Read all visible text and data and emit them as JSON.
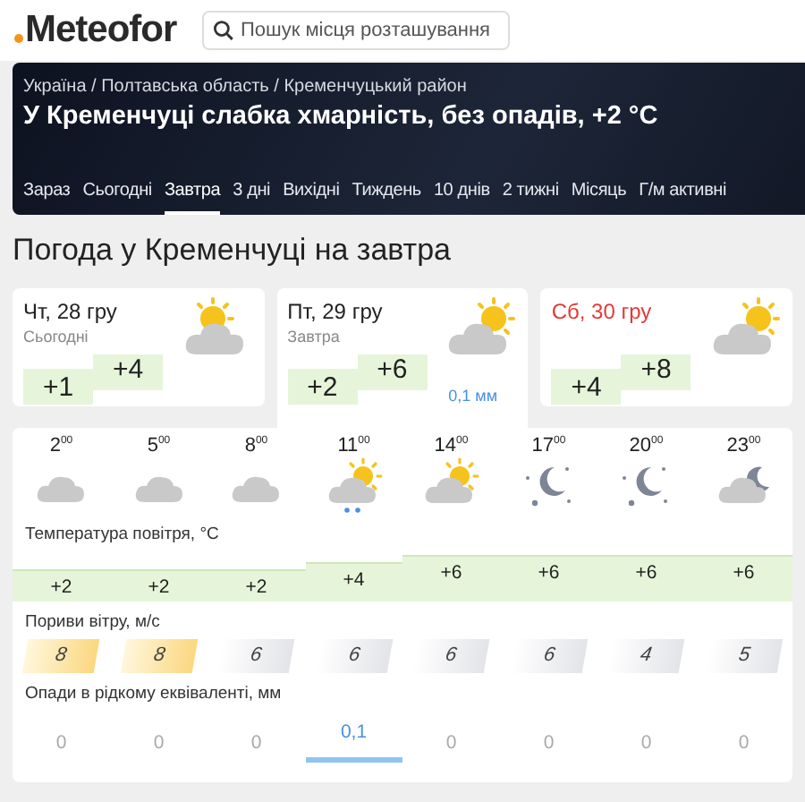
{
  "logo": "Meteofor",
  "search": {
    "placeholder": "Пошук місця розташування"
  },
  "banner": {
    "breadcrumb": "Україна / Полтавська область / Кременчуцький район",
    "headline": "У Кременчуці слабка хмарність, без опадів, +2 °C"
  },
  "tabs": [
    {
      "label": "Зараз",
      "selected": false
    },
    {
      "label": "Сьогодні",
      "selected": false
    },
    {
      "label": "Завтра",
      "selected": true
    },
    {
      "label": "3 дні",
      "selected": false
    },
    {
      "label": "Вихідні",
      "selected": false
    },
    {
      "label": "Тиждень",
      "selected": false
    },
    {
      "label": "10 днів",
      "selected": false
    },
    {
      "label": "2 тижні",
      "selected": false
    },
    {
      "label": "Місяць",
      "selected": false
    },
    {
      "label": "Г/м активні",
      "selected": false
    }
  ],
  "title": "Погода у Кременчуці на завтра",
  "days": [
    {
      "date": "Чт, 28 гру",
      "note": "Сьогодні",
      "min": "+1",
      "max": "+4",
      "kind": "sun-cloud",
      "weekend": false,
      "selected": false
    },
    {
      "date": "Пт, 29 гру",
      "note": "Завтра",
      "min": "+2",
      "max": "+6",
      "kind": "cloud-sun",
      "precip": "0,1 мм",
      "weekend": false,
      "selected": true
    },
    {
      "date": "Сб, 30 гру",
      "min": "+4",
      "max": "+8",
      "kind": "cloud-sun",
      "weekend": true,
      "selected": false
    }
  ],
  "hours": [
    {
      "hour": "2",
      "minutes": "00",
      "kind": "cloud",
      "temp": {
        "text": "+2",
        "kind": "low"
      },
      "gust": "8",
      "strong": true,
      "precip": "0",
      "rain": false
    },
    {
      "hour": "5",
      "minutes": "00",
      "kind": "cloud",
      "temp": {
        "text": "+2",
        "kind": "low"
      },
      "gust": "8",
      "strong": true,
      "precip": "0",
      "rain": false
    },
    {
      "hour": "8",
      "minutes": "00",
      "kind": "cloud",
      "temp": {
        "text": "+2",
        "kind": "low"
      },
      "gust": "6",
      "strong": false,
      "precip": "0",
      "rain": false
    },
    {
      "hour": "11",
      "minutes": "00",
      "kind": "cloud-sun-rain",
      "temp": {
        "text": "+4",
        "kind": "mid"
      },
      "gust": "6",
      "strong": false,
      "precip": "0,1",
      "rain": true
    },
    {
      "hour": "14",
      "minutes": "00",
      "kind": "cloud-sun",
      "temp": {
        "text": "+6",
        "kind": "high"
      },
      "gust": "6",
      "strong": false,
      "precip": "0",
      "rain": false
    },
    {
      "hour": "17",
      "minutes": "00",
      "kind": "moon-stars",
      "temp": {
        "text": "+6",
        "kind": "high"
      },
      "gust": "6",
      "strong": false,
      "precip": "0",
      "rain": false
    },
    {
      "hour": "20",
      "minutes": "00",
      "kind": "moon-stars",
      "temp": {
        "text": "+6",
        "kind": "high"
      },
      "gust": "4",
      "strong": false,
      "precip": "0",
      "rain": false
    },
    {
      "hour": "23",
      "minutes": "00",
      "kind": "cloud-moon",
      "temp": {
        "text": "+6",
        "kind": "high"
      },
      "gust": "5",
      "strong": false,
      "precip": "0",
      "rain": false
    }
  ],
  "labels": {
    "temperature": "Температура повітря, °C",
    "gusts": "Пориви вітру, м/с",
    "precipitation": "Опади в рідкому еквіваленті, мм"
  }
}
